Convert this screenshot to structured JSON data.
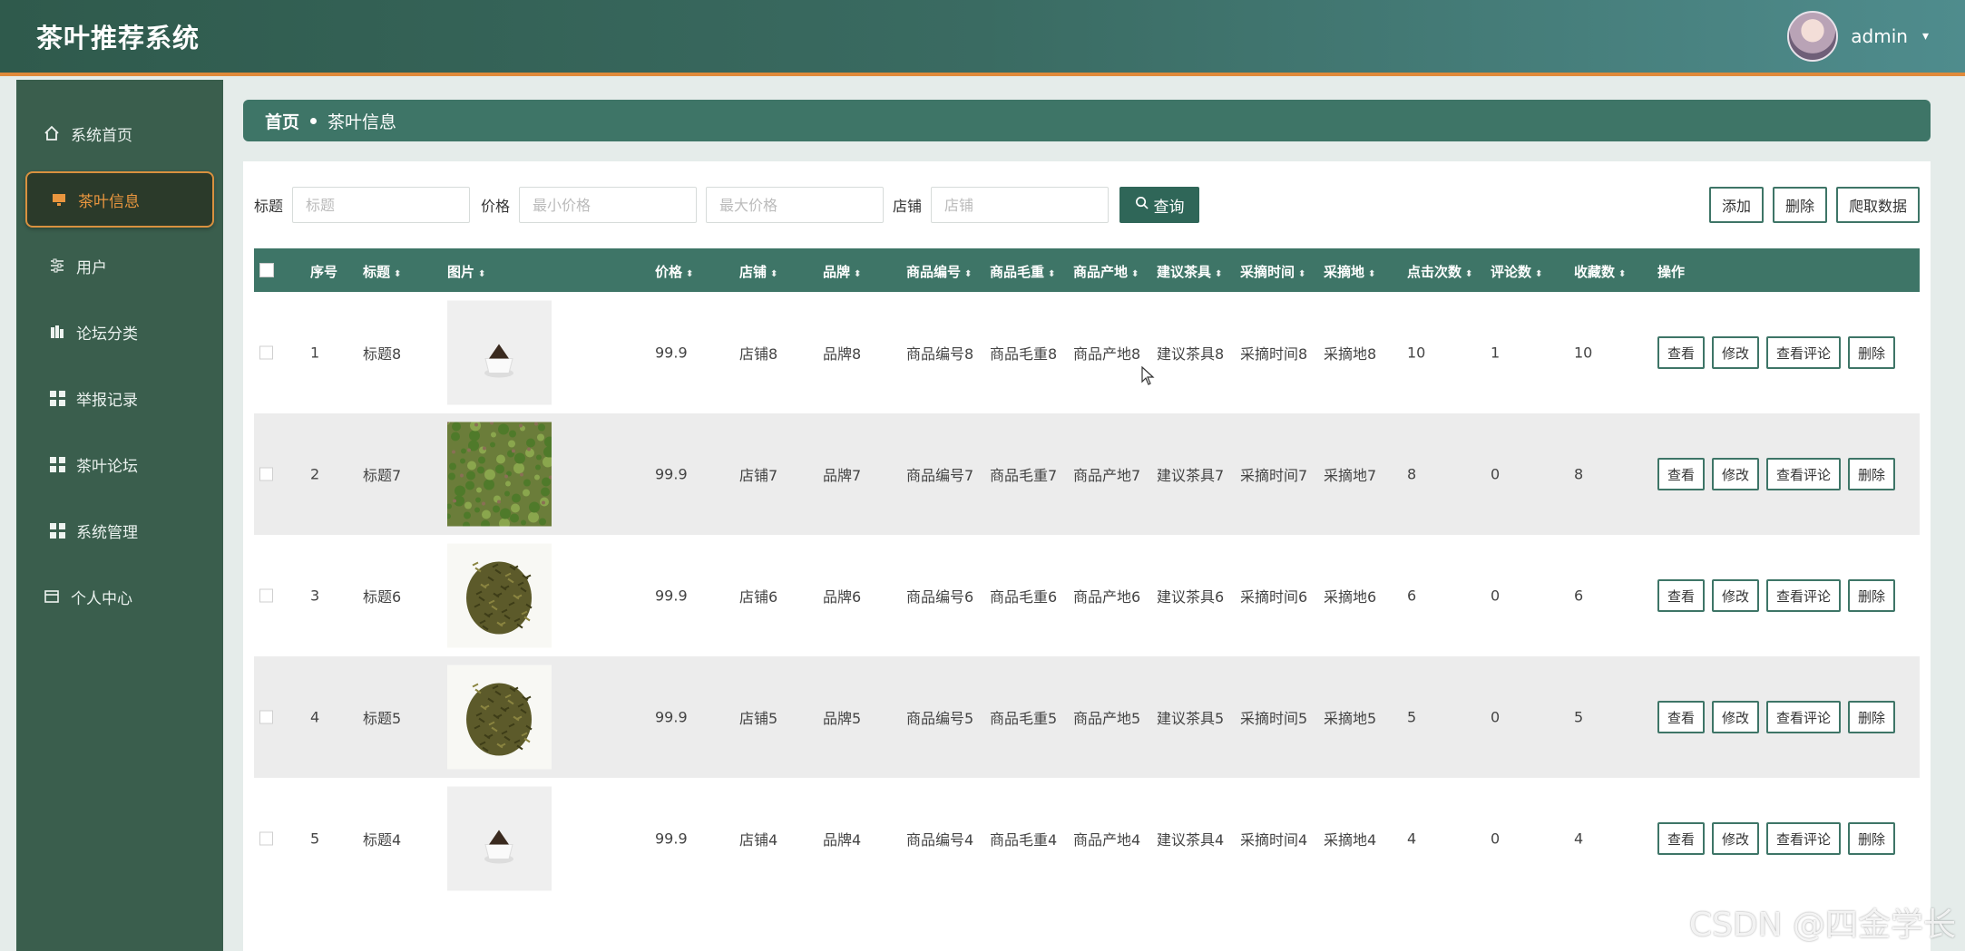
{
  "header": {
    "title": "茶叶推荐系统",
    "username": "admin",
    "caret": "▾"
  },
  "sidebar": {
    "items": [
      {
        "label": "系统首页",
        "icon": "home-icon"
      },
      {
        "label": "茶叶信息",
        "icon": "monitor-icon",
        "active": true
      },
      {
        "label": "用户",
        "icon": "sliders-icon"
      },
      {
        "label": "论坛分类",
        "icon": "chart-icon"
      },
      {
        "label": "举报记录",
        "icon": "grid-icon"
      },
      {
        "label": "茶叶论坛",
        "icon": "grid-icon"
      },
      {
        "label": "系统管理",
        "icon": "grid-icon"
      },
      {
        "label": "个人中心",
        "icon": "card-icon"
      }
    ]
  },
  "breadcrumb": {
    "home": "首页",
    "current": "茶叶信息"
  },
  "filters": {
    "title_label": "标题",
    "title_placeholder": "标题",
    "price_label": "价格",
    "min_price_placeholder": "最小价格",
    "max_price_placeholder": "最大价格",
    "shop_label": "店铺",
    "shop_placeholder": "店铺",
    "query_button": "查询"
  },
  "actions": {
    "add": "添加",
    "delete": "删除",
    "crawl": "爬取数据"
  },
  "table": {
    "columns": [
      "序号",
      "标题",
      "图片",
      "价格",
      "店铺",
      "品牌",
      "商品编号",
      "商品毛重",
      "商品产地",
      "建议茶具",
      "采摘时间",
      "采摘地",
      "点击次数",
      "评论数",
      "收藏数",
      "操作"
    ],
    "row_actions": {
      "view": "查看",
      "edit": "修改",
      "comments": "查看评论",
      "delete": "删除"
    },
    "rows": [
      {
        "no": "1",
        "title": "标题8",
        "image": "cup",
        "price": "99.9",
        "shop": "店铺8",
        "brand": "品牌8",
        "code": "商品编号8",
        "weight": "商品毛重8",
        "origin": "商品产地8",
        "teaware": "建议茶具8",
        "pick_time": "采摘时间8",
        "pick_place": "采摘地8",
        "clicks": "10",
        "comments": "1",
        "favorites": "10"
      },
      {
        "no": "2",
        "title": "标题7",
        "image": "field",
        "price": "99.9",
        "shop": "店铺7",
        "brand": "品牌7",
        "code": "商品编号7",
        "weight": "商品毛重7",
        "origin": "商品产地7",
        "teaware": "建议茶具7",
        "pick_time": "采摘时间7",
        "pick_place": "采摘地7",
        "clicks": "8",
        "comments": "0",
        "favorites": "8"
      },
      {
        "no": "3",
        "title": "标题6",
        "image": "leaves",
        "price": "99.9",
        "shop": "店铺6",
        "brand": "品牌6",
        "code": "商品编号6",
        "weight": "商品毛重6",
        "origin": "商品产地6",
        "teaware": "建议茶具6",
        "pick_time": "采摘时间6",
        "pick_place": "采摘地6",
        "clicks": "6",
        "comments": "0",
        "favorites": "6"
      },
      {
        "no": "4",
        "title": "标题5",
        "image": "leaves",
        "price": "99.9",
        "shop": "店铺5",
        "brand": "品牌5",
        "code": "商品编号5",
        "weight": "商品毛重5",
        "origin": "商品产地5",
        "teaware": "建议茶具5",
        "pick_time": "采摘时间5",
        "pick_place": "采摘地5",
        "clicks": "5",
        "comments": "0",
        "favorites": "5"
      },
      {
        "no": "5",
        "title": "标题4",
        "image": "cup",
        "price": "99.9",
        "shop": "店铺4",
        "brand": "品牌4",
        "code": "商品编号4",
        "weight": "商品毛重4",
        "origin": "商品产地4",
        "teaware": "建议茶具4",
        "pick_time": "采摘时间4",
        "pick_place": "采摘地4",
        "clicks": "4",
        "comments": "0",
        "favorites": "4"
      }
    ]
  },
  "watermark": "CSDN @四金学长"
}
